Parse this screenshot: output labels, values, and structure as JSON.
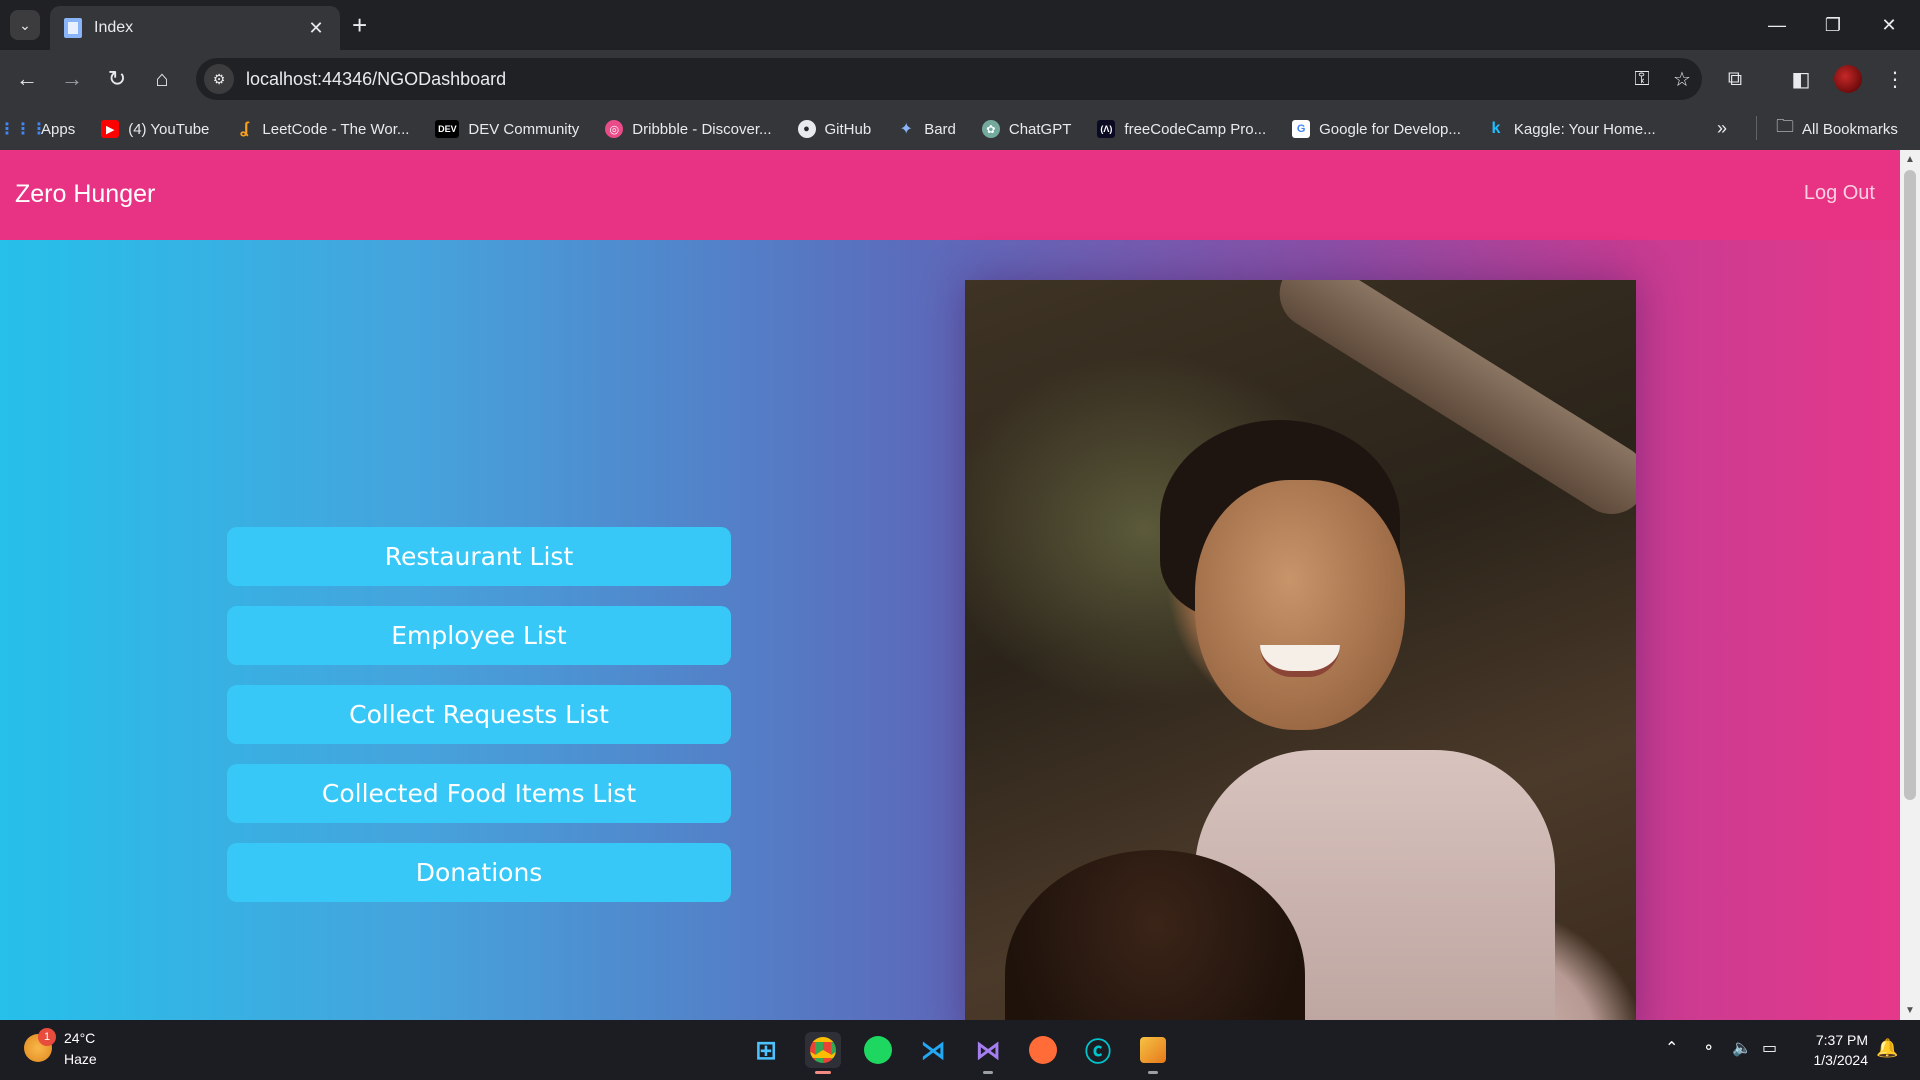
{
  "browser": {
    "tab_title": "Index",
    "url": "localhost:44346/NGODashboard",
    "bookmarks": [
      {
        "label": "Apps",
        "color": "#4285f4"
      },
      {
        "label": "(4) YouTube",
        "color": "#ff0000"
      },
      {
        "label": "LeetCode - The Wor...",
        "color": "#f89f1b"
      },
      {
        "label": "DEV Community",
        "color": "#000000"
      },
      {
        "label": "Dribbble - Discover...",
        "color": "#ea4c89"
      },
      {
        "label": "GitHub",
        "color": "#24292e"
      },
      {
        "label": "Bard",
        "color": "#6f8cf5"
      },
      {
        "label": "ChatGPT",
        "color": "#74aa9c"
      },
      {
        "label": "freeCodeCamp Pro...",
        "color": "#0a0a23"
      },
      {
        "label": "Google for Develop...",
        "color": "#ffffff"
      },
      {
        "label": "Kaggle: Your Home...",
        "color": "#20beff"
      }
    ],
    "all_bookmarks": "All Bookmarks"
  },
  "page": {
    "brand": "Zero Hunger",
    "logout": "Log Out",
    "menu": [
      "Restaurant List",
      "Employee List",
      "Collect Requests List",
      "Collected Food Items List",
      "Donations"
    ]
  },
  "taskbar": {
    "weather_temp": "24°C",
    "weather_cond": "Haze",
    "weather_badge": "1",
    "time": "7:37 PM",
    "date": "1/3/2024"
  },
  "colors": {
    "navbar": "#e83283",
    "button": "#38c8f7"
  }
}
